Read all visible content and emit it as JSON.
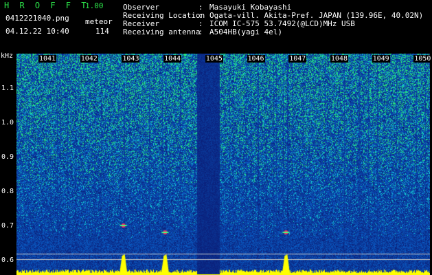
{
  "header": {
    "app_title": "H R O F F T",
    "version": "1.00",
    "filename": "0412221040.png",
    "datetime": "04.12.22 10:40",
    "meteor_label": "meteor",
    "meteor_count": "114",
    "info": [
      {
        "key": "Observer",
        "value": "Masayuki Kobayashi"
      },
      {
        "key": "Receiving Location",
        "value": "Ogata-vill. Akita-Pref. JAPAN (139.96E, 40.02N)"
      },
      {
        "key": "Receiver",
        "value": "ICOM IC-575 53.7492(@LCD)MHz USB"
      },
      {
        "key": "Receiving antenna",
        "value": "A504HB(yagi 4el)"
      }
    ]
  },
  "colors": {
    "accent": "#2ce64a",
    "background": "#0a1a8c",
    "echo": "#ffff00"
  },
  "chart_data": {
    "type": "heatmap",
    "ylabel": "kHz",
    "yticks": [
      "1.1",
      "1.0",
      "0.9",
      "0.8",
      "0.7",
      "0.6"
    ],
    "xticks": [
      "1041",
      "1042",
      "1043",
      "1044",
      "1045",
      "1046",
      "1047",
      "1048",
      "1049",
      "1050"
    ],
    "meteor_echoes": [
      {
        "minute": 1043.4,
        "freq_khz": 0.7
      },
      {
        "minute": 1044.4,
        "freq_khz": 0.68
      },
      {
        "minute": 1047.3,
        "freq_khz": 0.68
      }
    ]
  }
}
